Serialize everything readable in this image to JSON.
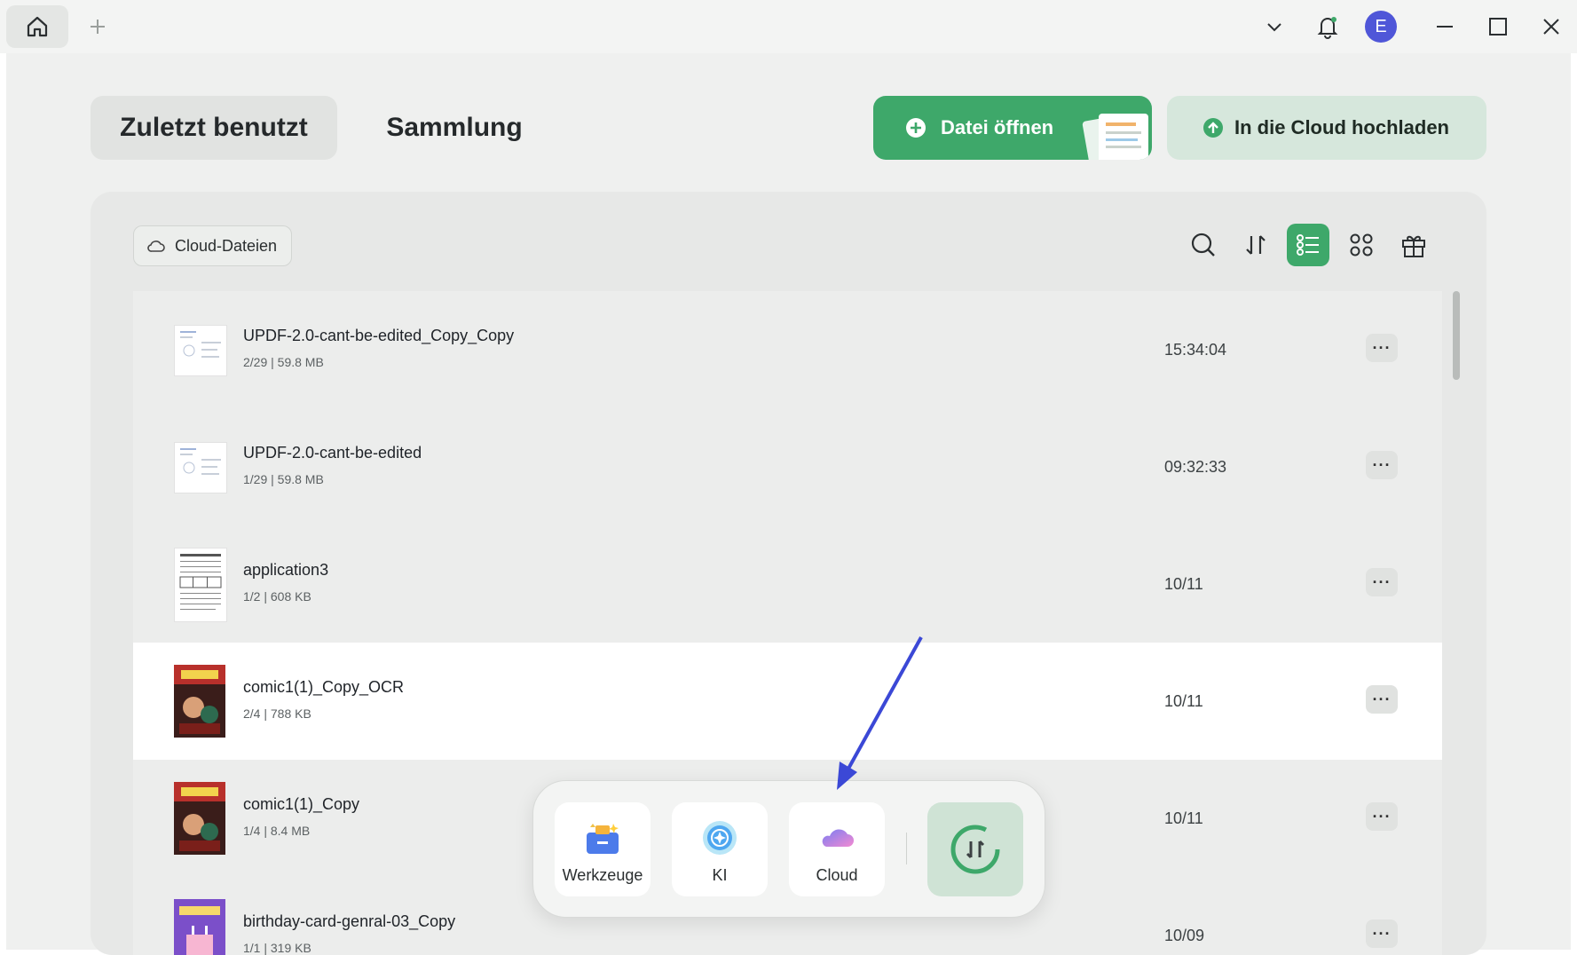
{
  "titlebar": {
    "icons": [
      "home-icon",
      "plus-icon",
      "chevron-down-icon",
      "bell-icon",
      "minimize-icon",
      "maximize-icon",
      "close-icon"
    ],
    "avatar_initial": "E"
  },
  "tabs": [
    {
      "label": "Zuletzt benutzt",
      "active": true
    },
    {
      "label": "Sammlung",
      "active": false
    }
  ],
  "actions": {
    "open_file": "Datei öffnen",
    "upload_cloud": "In die Cloud hochladen"
  },
  "filter": {
    "cloud_files": "Cloud-Dateien"
  },
  "toolbar": [
    "search-icon",
    "sort-icon",
    "list-view-icon",
    "grid-view-icon",
    "gift-icon"
  ],
  "files": [
    {
      "name": "UPDF-2.0-cant-be-edited_Copy_Copy",
      "meta": "2/29 | 59.8 MB",
      "time": "15:34:04"
    },
    {
      "name": "UPDF-2.0-cant-be-edited",
      "meta": "1/29 | 59.8 MB",
      "time": "09:32:33"
    },
    {
      "name": "application3",
      "meta": "1/2 | 608 KB",
      "time": "10/11"
    },
    {
      "name": "comic1(1)_Copy_OCR",
      "meta": "2/4 | 788 KB",
      "time": "10/11"
    },
    {
      "name": "comic1(1)_Copy",
      "meta": "1/4 | 8.4 MB",
      "time": "10/11"
    },
    {
      "name": "birthday-card-genral-03_Copy",
      "meta": "1/1 | 319 KB",
      "time": "10/09"
    }
  ],
  "more_label": "···",
  "dock": [
    {
      "label": "Werkzeuge",
      "icon": "toolbox-icon"
    },
    {
      "label": "KI",
      "icon": "ai-icon"
    },
    {
      "label": "Cloud",
      "icon": "cloud-icon"
    }
  ],
  "colors": {
    "accent": "#3ea86a",
    "avatar": "#4f56d8",
    "arrow": "#3b48d6"
  }
}
